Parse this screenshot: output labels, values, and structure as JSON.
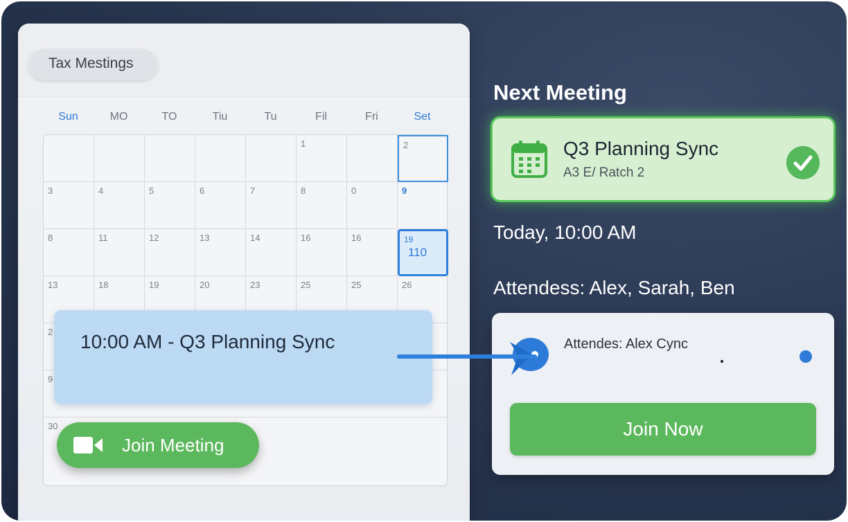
{
  "calendar": {
    "title": "Tax Mestings",
    "weekdays": [
      "Sun",
      "MO",
      "TO",
      "Tiu",
      "Tu",
      "Fil",
      "Fri",
      "Set"
    ],
    "rows": [
      [
        "",
        "",
        "",
        "",
        "",
        "1",
        "",
        "2"
      ],
      [
        "3",
        "4",
        "5",
        "6",
        "7",
        "8",
        "0",
        "9"
      ],
      [
        "8",
        "11",
        "12",
        "13",
        "14",
        "16",
        "16",
        "19"
      ],
      [
        "13",
        "18",
        "19",
        "20",
        "23",
        "25",
        "25",
        "26"
      ],
      [
        "2",
        "",
        "",
        "",
        "",
        "",
        "",
        ""
      ],
      [
        "9",
        "",
        "",
        "",
        "",
        "",
        "",
        ""
      ],
      [
        "30",
        "",
        "",
        "",
        "",
        "",
        "",
        ""
      ]
    ],
    "today_sub": "110",
    "event_text": "10:00 AM - Q3 Planning Sync",
    "join_meeting_label": "Join Meeting"
  },
  "next_meeting": {
    "heading": "Next Meeting",
    "title": "Q3 Planning Sync",
    "subtitle": "A3 E/ Ratch 2",
    "time": "Today, 10:00 AM",
    "attendees": "Attendess: Alex, Sarah, Ben"
  },
  "attendee_card": {
    "line": "Attendes: Alex Cync",
    "join_now_label": "Join Now"
  },
  "colors": {
    "accent_blue": "#2f7ad6",
    "green": "#5cb85c",
    "background": "#2a3852"
  },
  "icons": [
    "video-camera-icon",
    "calendar-icon",
    "check-icon",
    "avatar-icon",
    "arrow-icon"
  ]
}
